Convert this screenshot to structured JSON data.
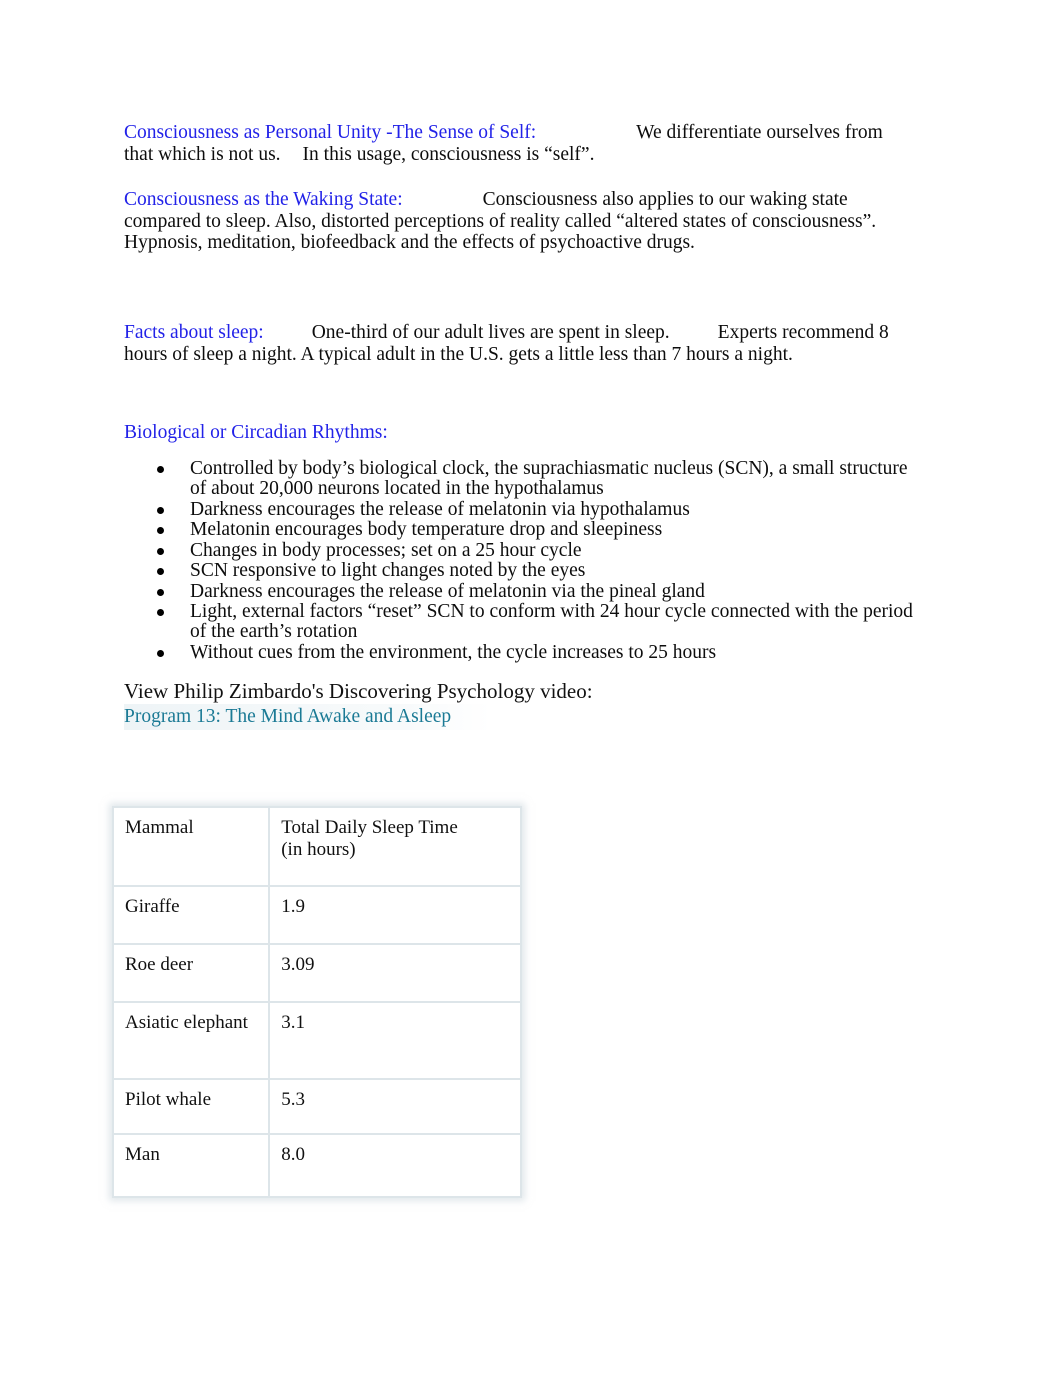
{
  "document": {
    "sections": {
      "self": {
        "heading": "Consciousness as Personal Unity -The Sense of Self:",
        "body_a": "We differentiate ourselves from that which is not us.",
        "body_b": "In this usage, consciousness is “self”."
      },
      "waking": {
        "heading": "Consciousness as the Waking State:",
        "body": "Consciousness also applies to our waking state compared to sleep. Also, distorted perceptions of reality called “altered states of consciousness”. Hypnosis, meditation, biofeedback and the effects of psychoactive drugs."
      },
      "facts": {
        "heading": "Facts about sleep:",
        "body_a": "One-third of our adult lives are spent in sleep.",
        "body_b": "Experts recommend 8 hours of sleep a night.  A typical adult in the U.S. gets a little less than 7 hours a night."
      },
      "circadian": {
        "heading": "Biological or Circadian Rhythms:",
        "bullets": [
          "Controlled by body’s biological clock, the     suprachiasmatic nucleus (SCN),      a small structure of about 20,000 neurons located in the hypothalamus",
          "Darkness encourages the release of melatonin via hypothalamus",
          " Melatonin encourages body temperature drop and sleepiness",
          " Changes in body processes; set on a 25 hour cycle",
          "SCN responsive to light changes noted by the eyes",
          " Darkness encourages the release of melatonin via the pineal gland",
          " Light, external factors “reset” SCN to conform with 24 hour cycle connected with the period of the earth’s rotation",
          " Without cues from the environment, the cycle increases to 25 hours"
        ]
      },
      "video": {
        "intro": "View Philip Zimbardo's Discovering Psychology video:",
        "link_text": "Program 13: The Mind Awake and Asleep"
      }
    },
    "sleep_table": {
      "headers": [
        "Mammal",
        "Total Daily Sleep Time\n(in hours)"
      ],
      "header_col2_line1": "Total Daily Sleep Time",
      "header_col2_line2": "(in hours)",
      "rows": [
        {
          "mammal": "Giraffe",
          "hours": "1.9"
        },
        {
          "mammal": "Roe deer",
          "hours": "3.09"
        },
        {
          "mammal": "Asiatic elephant",
          "hours": "3.1"
        },
        {
          "mammal": "Pilot whale",
          "hours": "5.3"
        },
        {
          "mammal": "Man",
          "hours": "8.0"
        }
      ]
    },
    "colors": {
      "heading_blue": "#2222E8",
      "link_teal": "#1B7A95",
      "body_black": "#0d0d0d",
      "table_border": "#dde5e9"
    }
  }
}
